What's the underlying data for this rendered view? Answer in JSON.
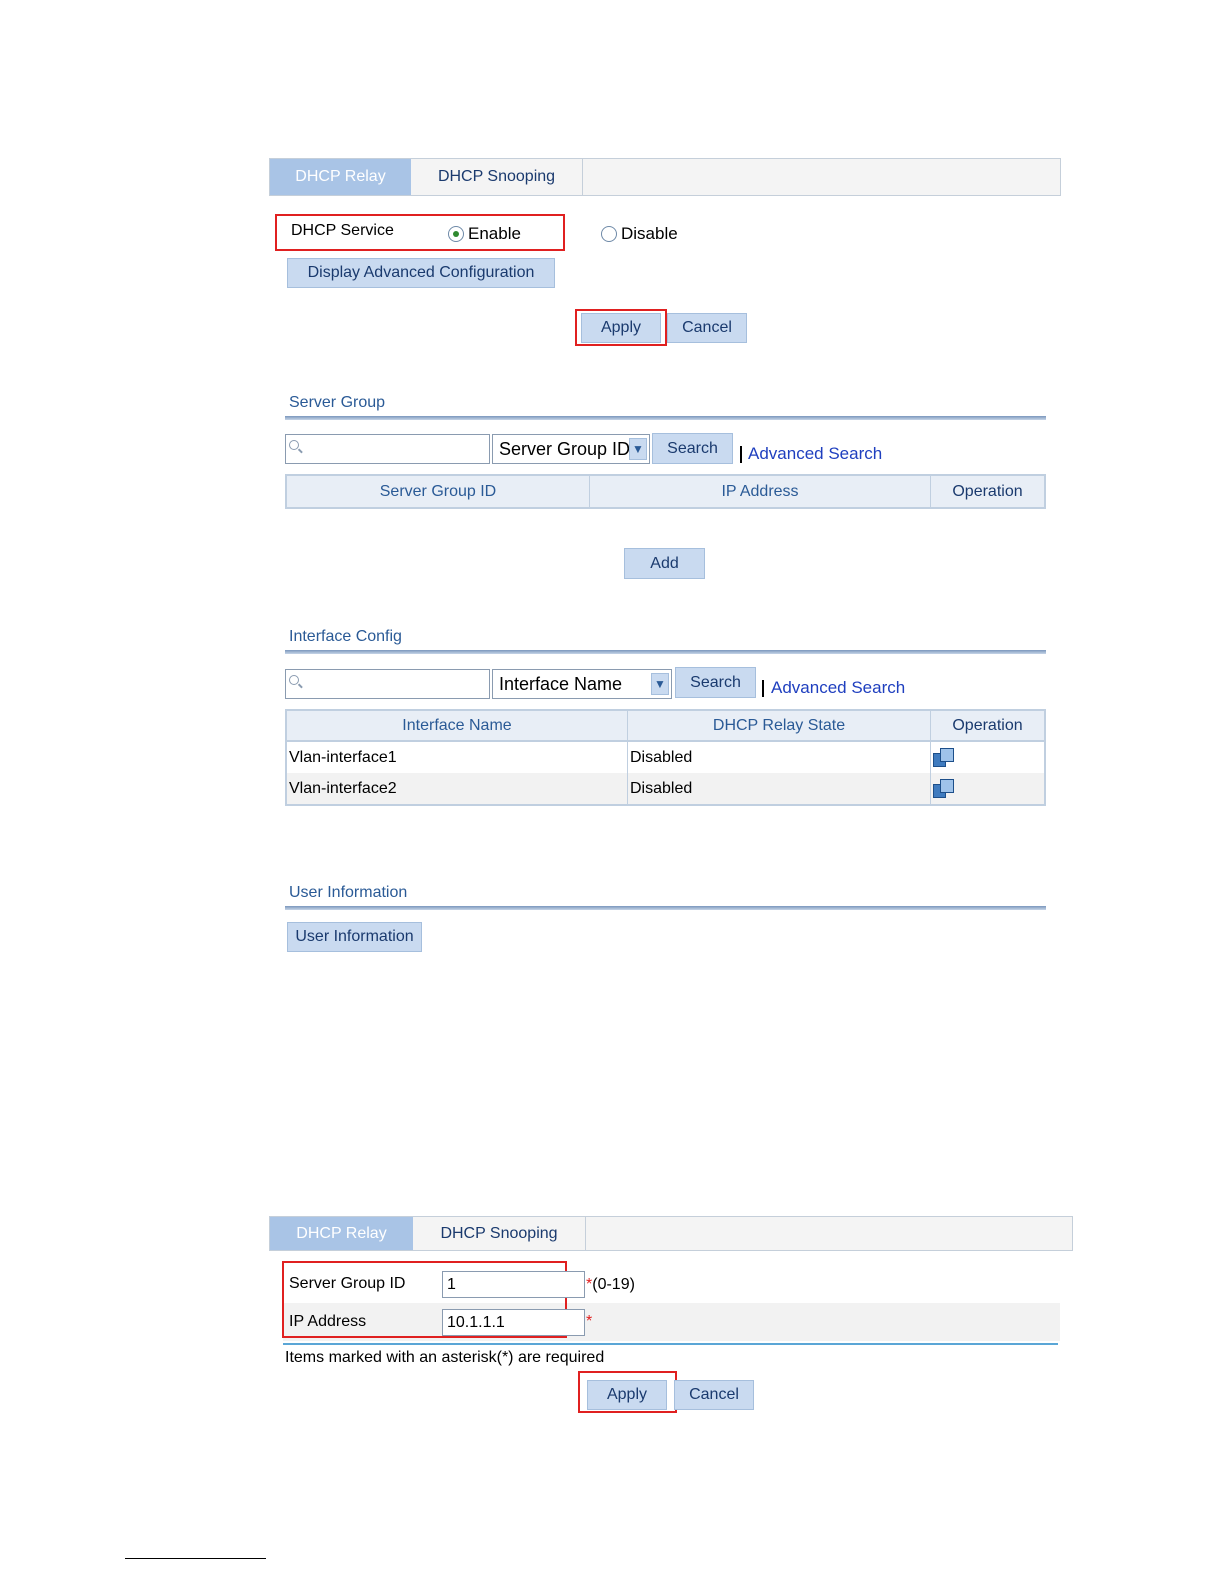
{
  "panel1": {
    "tabs": [
      {
        "label": "DHCP Relay",
        "active": true
      },
      {
        "label": "DHCP Snooping",
        "active": false
      }
    ],
    "dhcp_service": {
      "label": "DHCP Service",
      "options": [
        "Enable",
        "Disable"
      ],
      "selected": "Enable"
    },
    "advanced_config_button": "Display Advanced Configuration",
    "apply_button": "Apply",
    "cancel_button": "Cancel",
    "server_group": {
      "title": "Server Group",
      "search_input_value": "",
      "select_value": "Server Group ID",
      "search_button": "Search",
      "advanced_search": "Advanced Search",
      "columns": [
        "Server Group ID",
        "IP Address",
        "Operation"
      ],
      "rows": [],
      "add_button": "Add"
    },
    "interface_config": {
      "title": "Interface Config",
      "search_input_value": "",
      "select_value": "Interface Name",
      "search_button": "Search",
      "advanced_search": "Advanced Search",
      "columns": [
        "Interface Name",
        "DHCP Relay State",
        "Operation"
      ],
      "rows": [
        {
          "interface": "Vlan-interface1",
          "state": "Disabled",
          "operation_icon": "edit-config-icon"
        },
        {
          "interface": "Vlan-interface2",
          "state": "Disabled",
          "operation_icon": "edit-config-icon"
        }
      ]
    },
    "user_information": {
      "title": "User Information",
      "button": "User Information"
    }
  },
  "panel2": {
    "tabs": [
      {
        "label": "DHCP Relay",
        "active": true
      },
      {
        "label": "DHCP Snooping",
        "active": false
      }
    ],
    "fields": [
      {
        "label": "Server Group ID",
        "value": "1",
        "required": "*",
        "hint": "(0-19)"
      },
      {
        "label": "IP Address",
        "value": "10.1.1.1",
        "required": "*",
        "hint": ""
      }
    ],
    "required_note": "Items marked with an asterisk(*) are required",
    "apply_button": "Apply",
    "cancel_button": "Cancel"
  },
  "colors": {
    "tab_active": "#a9c4e6",
    "button_bg": "#c9daf0",
    "highlight_box": "#e02020",
    "link": "#1f3fbf",
    "section_title": "#2a5a96"
  }
}
